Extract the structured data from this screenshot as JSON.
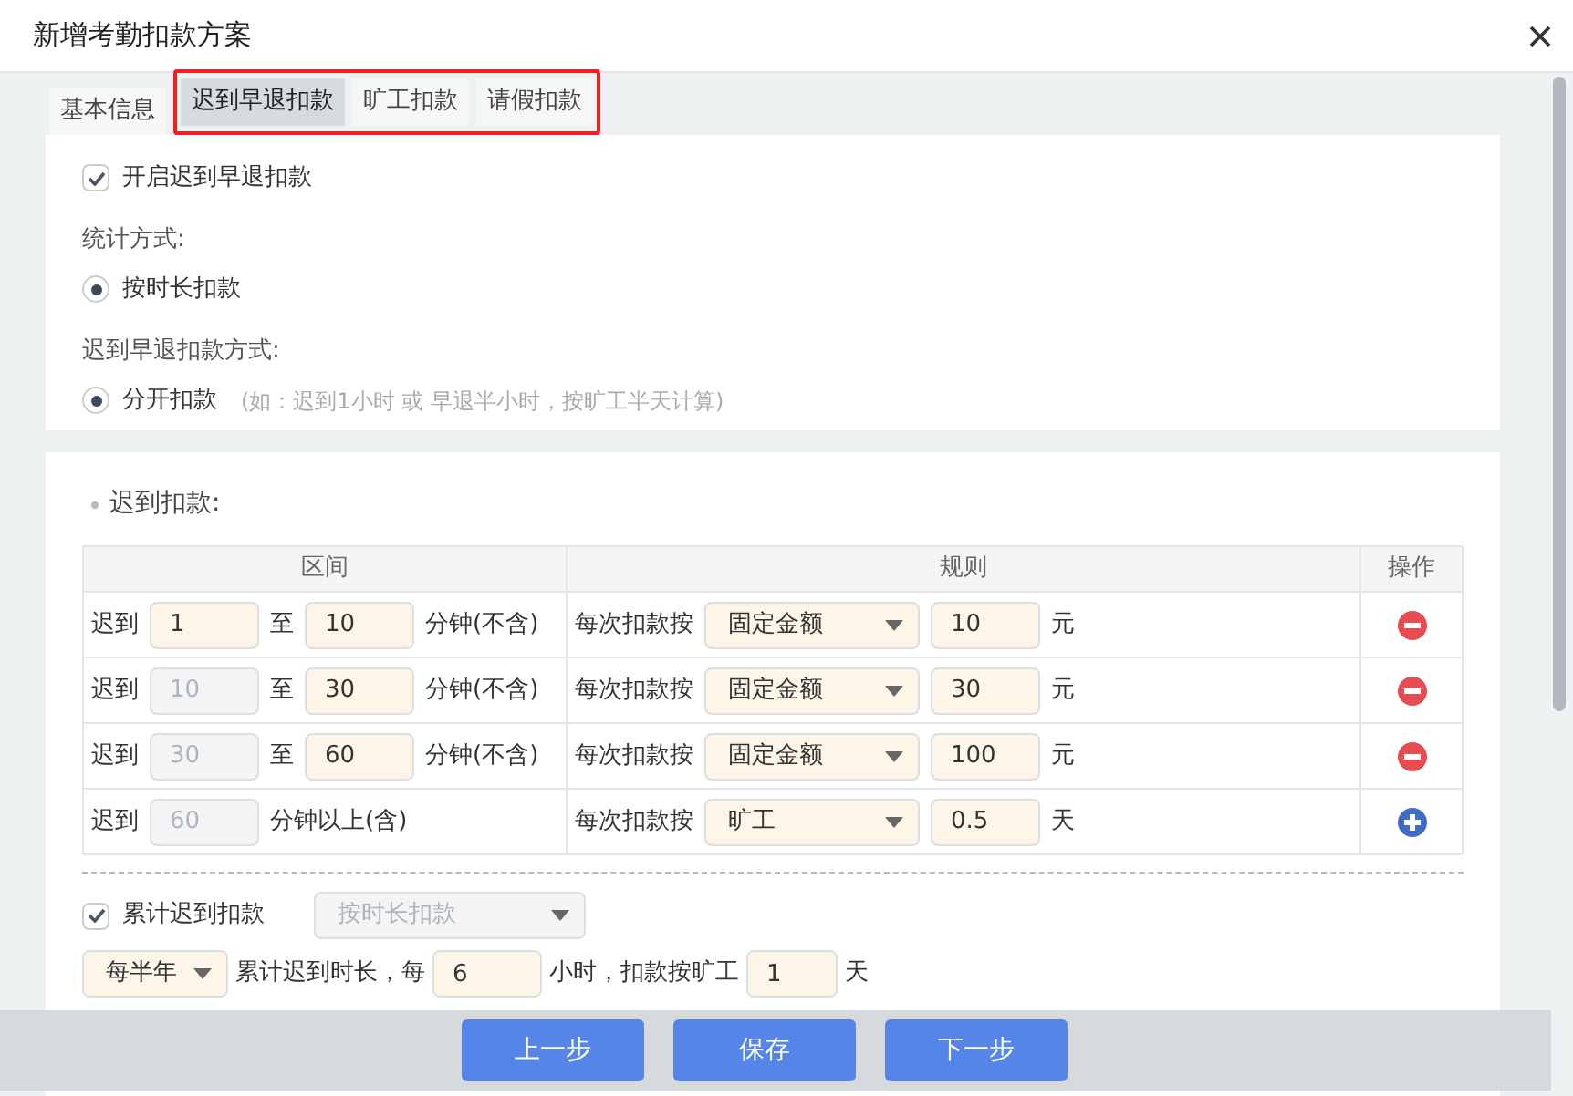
{
  "window": {
    "title": "新增考勤扣款方案"
  },
  "tabs": [
    {
      "label": "基本信息",
      "selected": false,
      "annotated": false
    },
    {
      "label": "迟到早退扣款",
      "selected": true,
      "annotated": true
    },
    {
      "label": "旷工扣款",
      "selected": false,
      "annotated": true
    },
    {
      "label": "请假扣款",
      "selected": false,
      "annotated": true
    }
  ],
  "settings": {
    "enable": {
      "label": "开启迟到早退扣款",
      "checked": true
    },
    "stat_method": {
      "label": "统计方式:",
      "options": [
        {
          "label": "按时长扣款",
          "selected": true
        }
      ]
    },
    "deduct_mode": {
      "label": "迟到早退扣款方式:",
      "options": [
        {
          "label": "分开扣款",
          "selected": true,
          "note": "(如：迟到1小时 或 早退半小时，按旷工半天计算)"
        }
      ]
    }
  },
  "late": {
    "title": "迟到扣款:",
    "columns": [
      "区间",
      "规则",
      "操作"
    ],
    "rows": [
      {
        "prefix": "迟到",
        "from": "1",
        "from_disabled": false,
        "to_word": "至",
        "to": "10",
        "unit": "分钟(不含)",
        "rule_label": "每次扣款按",
        "method": "固定金额",
        "amount": "10",
        "amount_unit": "元",
        "kind": "remove"
      },
      {
        "prefix": "迟到",
        "from": "10",
        "from_disabled": true,
        "to_word": "至",
        "to": "30",
        "unit": "分钟(不含)",
        "rule_label": "每次扣款按",
        "method": "固定金额",
        "amount": "30",
        "amount_unit": "元",
        "kind": "remove"
      },
      {
        "prefix": "迟到",
        "from": "30",
        "from_disabled": true,
        "to_word": "至",
        "to": "60",
        "unit": "分钟(不含)",
        "rule_label": "每次扣款按",
        "method": "固定金额",
        "amount": "100",
        "amount_unit": "元",
        "kind": "remove"
      },
      {
        "prefix": "迟到",
        "from": "60",
        "from_disabled": true,
        "open_unit": "分钟以上(含)",
        "rule_label": "每次扣款按",
        "method": "旷工",
        "amount": "0.5",
        "amount_unit": "天",
        "kind": "add"
      }
    ],
    "cumulative": {
      "label": "累计迟到扣款",
      "checked": true,
      "method": {
        "value": "按时长扣款",
        "disabled": true
      },
      "period": "每半年",
      "text_1": "累计迟到时长，每",
      "hours": "6",
      "text_2": "小时，扣款按旷工",
      "days": "1",
      "text_3": "天"
    }
  },
  "footer": {
    "buttons": [
      "上一步",
      "保存",
      "下一步"
    ]
  }
}
